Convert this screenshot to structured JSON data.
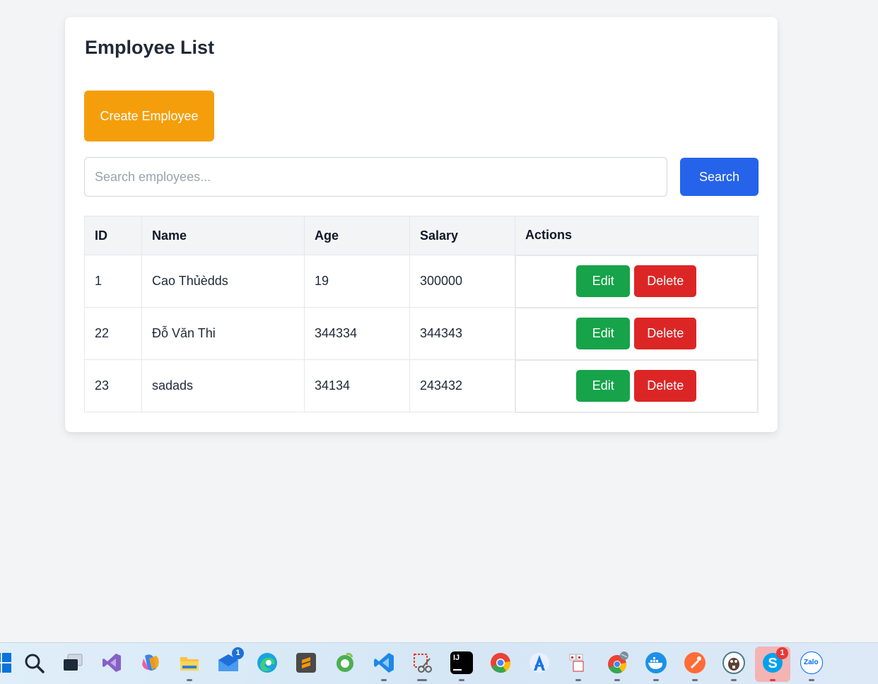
{
  "page": {
    "title": "Employee List",
    "create_button": "Create Employee",
    "search": {
      "placeholder": "Search employees...",
      "value": "",
      "button": "Search"
    }
  },
  "table": {
    "headers": {
      "id": "ID",
      "name": "Name",
      "age": "Age",
      "salary": "Salary",
      "actions": "Actions"
    },
    "rows": [
      {
        "id": "1",
        "name": "Cao Thủèdds",
        "age": "19",
        "salary": "300000",
        "edit": "Edit",
        "delete": "Delete"
      },
      {
        "id": "22",
        "name": "Đỗ Văn Thi",
        "age": "344334",
        "salary": "344343",
        "edit": "Edit",
        "delete": "Delete"
      },
      {
        "id": "23",
        "name": "sadads",
        "age": "34134",
        "salary": "243432",
        "edit": "Edit",
        "delete": "Delete"
      }
    ]
  },
  "colors": {
    "create": "#f59e0b",
    "search": "#2563eb",
    "edit": "#16a34a",
    "delete": "#dc2626"
  },
  "taskbar": {
    "icons": [
      "windows-start-icon",
      "search-icon",
      "task-view-icon",
      "visual-studio-icon",
      "copilot-icon",
      "file-explorer-icon",
      "mail-icon",
      "edge-icon",
      "sublime-text-icon",
      "coccoc-icon",
      "vscode-icon",
      "snipping-tool-icon",
      "intellij-icon",
      "chrome-icon",
      "android-studio-icon",
      "app-icon",
      "chrome-profile-icon",
      "docker-icon",
      "postman-icon",
      "dbeaver-icon",
      "skype-icon",
      "zalo-icon"
    ],
    "mail_badge": "1",
    "skype_badge": "1",
    "intellij_label": "IJ",
    "zalo_label": "Zalo"
  }
}
